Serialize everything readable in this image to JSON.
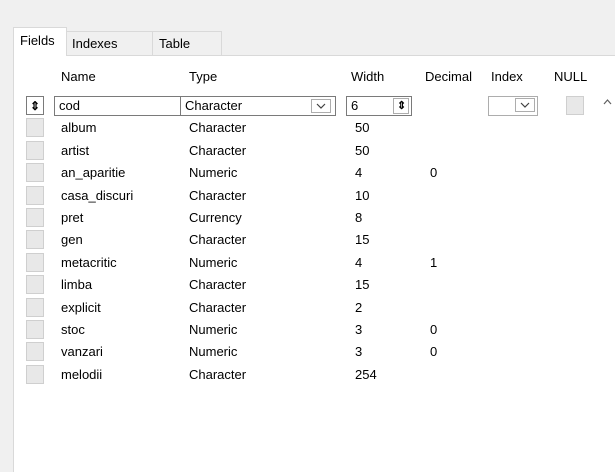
{
  "tabs": [
    "Fields",
    "Indexes",
    "Table"
  ],
  "headers": {
    "name": "Name",
    "type": "Type",
    "width": "Width",
    "decimal": "Decimal",
    "index": "Index",
    "null": "NULL"
  },
  "current_row": {
    "name": "cod",
    "type": "Character",
    "width": "6",
    "decimal": ""
  },
  "rows": [
    {
      "name": "album",
      "type": "Character",
      "width": "50",
      "decimal": ""
    },
    {
      "name": "artist",
      "type": "Character",
      "width": "50",
      "decimal": ""
    },
    {
      "name": "an_aparitie",
      "type": "Numeric",
      "width": "4",
      "decimal": "0"
    },
    {
      "name": "casa_discuri",
      "type": "Character",
      "width": "10",
      "decimal": ""
    },
    {
      "name": "pret",
      "type": "Currency",
      "width": "8",
      "decimal": ""
    },
    {
      "name": "gen",
      "type": "Character",
      "width": "15",
      "decimal": ""
    },
    {
      "name": "metacritic",
      "type": "Numeric",
      "width": "4",
      "decimal": "1"
    },
    {
      "name": "limba",
      "type": "Character",
      "width": "15",
      "decimal": ""
    },
    {
      "name": "explicit",
      "type": "Character",
      "width": "2",
      "decimal": ""
    },
    {
      "name": "stoc",
      "type": "Numeric",
      "width": "3",
      "decimal": "0"
    },
    {
      "name": "vanzari",
      "type": "Numeric",
      "width": "3",
      "decimal": "0"
    },
    {
      "name": "melodii",
      "type": "Character",
      "width": "254",
      "decimal": ""
    }
  ],
  "icons": {
    "row_selector": "up-down-arrows-icon",
    "dropdown": "chevron-down-icon",
    "spinner": "up-down-arrows-icon",
    "scroll_up": "chevron-up-icon"
  }
}
